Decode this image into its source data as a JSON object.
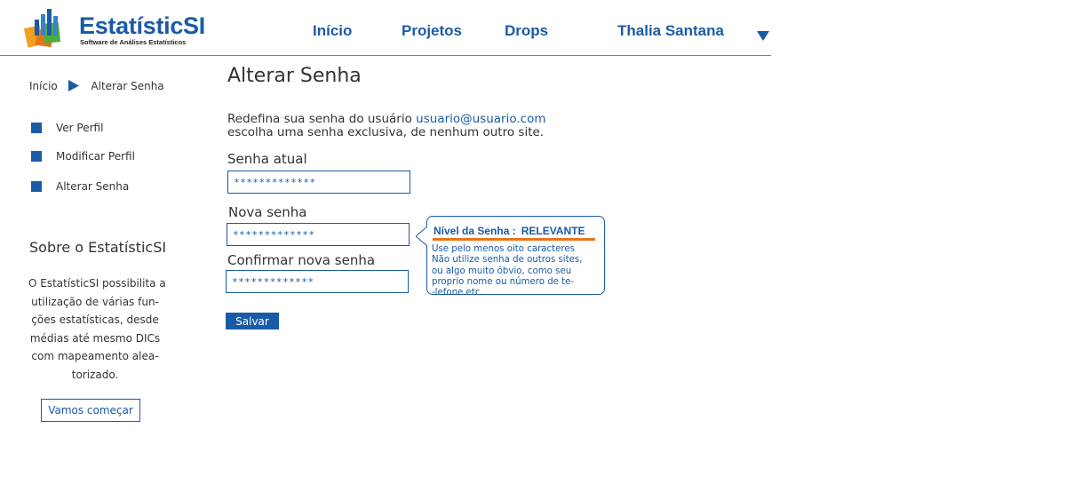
{
  "header": {
    "logo_title": "EstatísticSI",
    "logo_subtitle": "Software de Análises Estatísticos",
    "nav": [
      "Início",
      "Projetos",
      "Drops"
    ],
    "user_name": "Thalia Santana"
  },
  "breadcrumb": {
    "home": "Início",
    "current": "Alterar Senha"
  },
  "sidebar": {
    "items": [
      {
        "label": "Ver Perfil"
      },
      {
        "label": "Modificar Perfil"
      },
      {
        "label": "Alterar Senha"
      }
    ],
    "about_title": "Sobre o EstatísticSI",
    "about_lines": [
      "O EstatísticSI possibilita a",
      "utilização de várias fun-",
      "ções estatísticas, desde",
      "médias até mesmo DICs",
      "com mapeamento alea-",
      "torizado."
    ],
    "cta": "Vamos começar"
  },
  "main": {
    "title": "Alterar Senha",
    "intro_prefix": "Redefina sua senha do usuário",
    "intro_email": "usuario@usuario.com",
    "intro_line2": "escolha uma senha exclusiva, de nenhum outro site.",
    "current_password": {
      "label": "Senha atual",
      "value": "*************"
    },
    "new_password": {
      "label": "Nova senha",
      "value": "*************"
    },
    "confirm_password": {
      "label": "Confirmar nova senha",
      "value": "*************"
    },
    "save": "Salvar"
  },
  "tooltip": {
    "heading": "Nível da Senha :",
    "level": "RELEVANTE",
    "lines": [
      "Use pelo menos oito caracteres",
      "Não utilize senha de outros sites,",
      "ou algo  muito óbvio, como seu",
      "proprio nome ou número de te-",
      "-lefone etc."
    ]
  },
  "colors": {
    "primary": "#1a5ba6",
    "strength_bar": "#e8741a"
  }
}
